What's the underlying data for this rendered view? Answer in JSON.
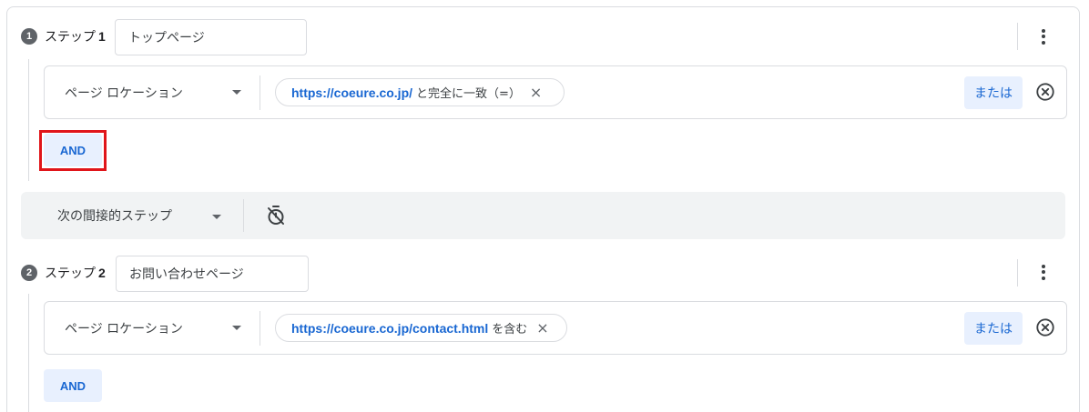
{
  "steps": [
    {
      "number": "1",
      "label": "ステップ",
      "label_num": "1",
      "name": "トップページ",
      "condition": {
        "dimension": "ページ ロケーション",
        "value_url": "https://coeure.co.jp/",
        "match_text": "と完全に一致（=）",
        "or_label": "または"
      },
      "and_label": "AND"
    },
    {
      "number": "2",
      "label": "ステップ",
      "label_num": "2",
      "name": "お問い合わせページ",
      "condition": {
        "dimension": "ページ ロケーション",
        "value_url": "https://coeure.co.jp/contact.html",
        "match_text": "を含む",
        "or_label": "または"
      },
      "and_label": "AND"
    }
  ],
  "between_steps": {
    "label": "次の間接的ステップ"
  },
  "icons": {
    "remove_chip": "×",
    "kebab": "more-vert-icon",
    "remove_condition": "cancel-circle-icon",
    "timer": "timer-off-icon"
  },
  "colors": {
    "accent": "#1967d2",
    "accent_bg": "#e8f0fe",
    "highlight": "#e0151a"
  }
}
